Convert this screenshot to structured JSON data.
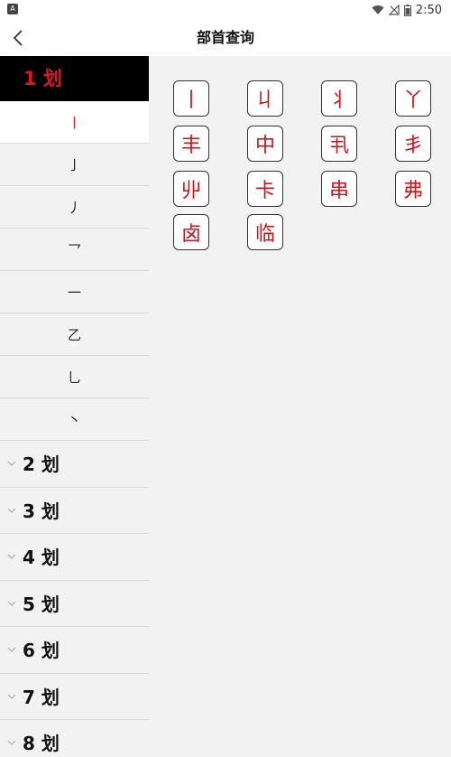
{
  "status_bar": {
    "left_icon": "A",
    "time": "2:50",
    "icons": [
      "wifi-icon",
      "signal-icon",
      "battery-icon"
    ]
  },
  "header": {
    "title": "部首查询",
    "back_icon": "chevron-left-icon"
  },
  "sidebar": {
    "active_group": "1 划",
    "stroke_items": [
      "丨",
      "亅",
      "丿",
      "乛",
      "一",
      "乙",
      "乚",
      "丶"
    ],
    "selected_index": 0,
    "groups": [
      "2 划",
      "3 划",
      "4 划",
      "5 划",
      "6 划",
      "7 划",
      "8 划"
    ]
  },
  "radicals": [
    "丨",
    "丩",
    "丬",
    "丫",
    "丰",
    "中",
    "丮",
    "丯",
    "丱",
    "卡",
    "串",
    "弗",
    "卤",
    "临"
  ],
  "colors": {
    "accent_red": "#e8141b",
    "sidebar_bg": "#f2f2f2",
    "active_header_bg": "#000000"
  }
}
